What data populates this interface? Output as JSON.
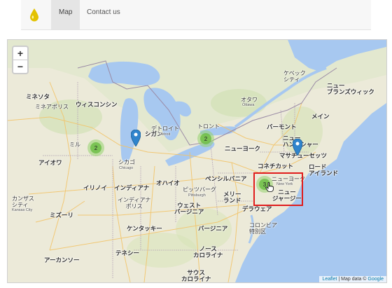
{
  "nav": {
    "tabs": [
      {
        "label": "Map",
        "active": true
      },
      {
        "label": "Contact us",
        "active": false
      }
    ],
    "logo_icon": "oil-drop-icon",
    "logo_color": "#e3c200"
  },
  "map": {
    "zoom_in": "+",
    "zoom_out": "−",
    "labels": {
      "minnesota": "ミネソタ",
      "minneapolis": "ミネアポリス",
      "wisconsin": "ウィスコンシン",
      "michigan": "シガン",
      "milwaukee": "ミル",
      "iowa": "アイオワ",
      "chicago_ja": "シカゴ",
      "chicago_en": "Chicago",
      "detroit_ja": "デトロイト",
      "detroit_en": "Detroit",
      "toronto": "トロント",
      "ottawa": "オタワ",
      "ottawa_en": "Ottawa",
      "quebec": "ケベック\nシティ",
      "new_brunswick": "ニュー\nブランズウィック",
      "vermont": "バーモント",
      "maine": "メイン",
      "new_hampshire": "ニュー\nハンプシャー",
      "massachusetts": "マサチューセッツ",
      "rhode_island": "ロード\nアイランド",
      "connecticut": "コネチカット",
      "new_york_state": "ニューヨーク",
      "new_york_city": "ニューヨーク",
      "new_york_en": "New York",
      "new_jersey": "ニュー\nジャージー",
      "pennsylvania": "ペンシルバニア",
      "pittsburgh": "ピッツバーグ",
      "pittsburgh_en": "Pittsburgh",
      "ohio": "オハイオ",
      "indiana": "インディアナ",
      "indianapolis": "インディアナ\nポリス",
      "illinois": "イリノイ",
      "maryland": "メリー\nランド",
      "delaware": "デラウェア",
      "west_virginia": "ウェスト\nバージニア",
      "virginia": "バージニア",
      "dc": "コロンビア\n特別区",
      "kansas_city": "カンザス\nシティ",
      "kansas_city_en": "Kansas City",
      "missouri": "ミズーリ",
      "kentucky": "ケンタッキー",
      "tennessee": "テネシー",
      "arkansas": "アーカンソー",
      "north_carolina": "ノース\nカロライナ",
      "south_carolina": "サウス\nカロライナ"
    },
    "clusters": [
      {
        "count": "2"
      },
      {
        "count": "2"
      },
      {
        "count": "3"
      }
    ],
    "attribution": {
      "leaflet": "Leaflet",
      "separator": " | Map data © ",
      "google": "Google"
    }
  }
}
